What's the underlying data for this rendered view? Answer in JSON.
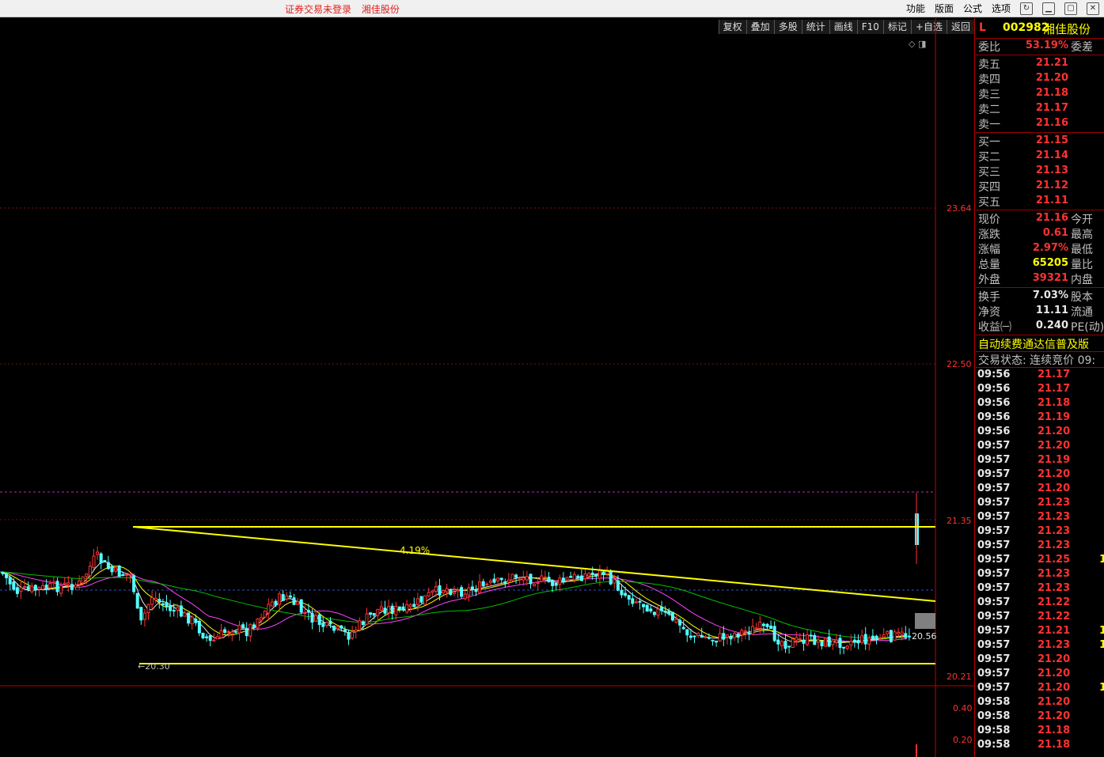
{
  "window": {
    "status_text": "证券交易未登录",
    "stock_name": "湘佳股份",
    "menu": [
      "功能",
      "版面",
      "公式",
      "选项"
    ]
  },
  "toolbar": [
    "复权",
    "叠加",
    "多股",
    "统计",
    "画线",
    "F10",
    "标记",
    "+自选",
    "返回"
  ],
  "chart_labels": {
    "pct_label": "4.19%",
    "low_label": "20.30",
    "ma_label": "20.56",
    "corner_icons": "◇ ◨"
  },
  "chart_data": {
    "type": "candlestick",
    "y_ticks": [
      "23.64",
      "22.50",
      "21.35",
      "20.21"
    ],
    "volume_ticks": [
      "0.40",
      "0.20"
    ],
    "ylim": [
      20.21,
      24.8
    ],
    "annotations": [
      {
        "text": "4.19%",
        "type": "trend-line"
      },
      {
        "text": "20.30",
        "type": "low-marker"
      },
      {
        "text": "20.56",
        "type": "ma-value"
      }
    ]
  },
  "quote": {
    "code": "002982",
    "name": "湘佳股份",
    "flag": "L",
    "weibi_label": "委比",
    "weibi": "53.19%",
    "weicha_label": "委差",
    "sell": [
      {
        "label": "卖五",
        "price": "21.21"
      },
      {
        "label": "卖四",
        "price": "21.20"
      },
      {
        "label": "卖三",
        "price": "21.18"
      },
      {
        "label": "卖二",
        "price": "21.17"
      },
      {
        "label": "卖一",
        "price": "21.16"
      }
    ],
    "buy": [
      {
        "label": "买一",
        "price": "21.15"
      },
      {
        "label": "买二",
        "price": "21.14"
      },
      {
        "label": "买三",
        "price": "21.13"
      },
      {
        "label": "买四",
        "price": "21.12"
      },
      {
        "label": "买五",
        "price": "21.11"
      }
    ],
    "stats1": [
      {
        "label": "现价",
        "value": "21.16",
        "color": "red",
        "label2": "今开"
      },
      {
        "label": "涨跌",
        "value": "0.61",
        "color": "red",
        "label2": "最高"
      },
      {
        "label": "涨幅",
        "value": "2.97%",
        "color": "red",
        "label2": "最低"
      },
      {
        "label": "总量",
        "value": "65205",
        "color": "yel",
        "label2": "量比"
      },
      {
        "label": "外盘",
        "value": "39321",
        "color": "red",
        "label2": "内盘"
      }
    ],
    "stats2": [
      {
        "label": "换手",
        "value": "7.03%",
        "color": "wht",
        "label2": "股本"
      },
      {
        "label": "净资",
        "value": "11.11",
        "color": "wht",
        "label2": "流通"
      },
      {
        "label": "收益㈠",
        "value": "0.240",
        "color": "wht",
        "label2": "PE(动)"
      }
    ],
    "notice": "自动续费通达信普及版",
    "trade_status": "交易状态: 连续竞价 09:",
    "ticks": [
      {
        "t": "09:56",
        "p": "21.17",
        "v": ""
      },
      {
        "t": "09:56",
        "p": "21.17",
        "v": ""
      },
      {
        "t": "09:56",
        "p": "21.18",
        "v": ""
      },
      {
        "t": "09:56",
        "p": "21.19",
        "v": ""
      },
      {
        "t": "09:56",
        "p": "21.20",
        "v": ""
      },
      {
        "t": "09:57",
        "p": "21.20",
        "v": ""
      },
      {
        "t": "09:57",
        "p": "21.19",
        "v": ""
      },
      {
        "t": "09:57",
        "p": "21.20",
        "v": ""
      },
      {
        "t": "09:57",
        "p": "21.20",
        "v": ""
      },
      {
        "t": "09:57",
        "p": "21.23",
        "v": ""
      },
      {
        "t": "09:57",
        "p": "21.23",
        "v": ""
      },
      {
        "t": "09:57",
        "p": "21.23",
        "v": ""
      },
      {
        "t": "09:57",
        "p": "21.23",
        "v": ""
      },
      {
        "t": "09:57",
        "p": "21.25",
        "v": "1"
      },
      {
        "t": "09:57",
        "p": "21.23",
        "v": ""
      },
      {
        "t": "09:57",
        "p": "21.23",
        "v": ""
      },
      {
        "t": "09:57",
        "p": "21.22",
        "v": ""
      },
      {
        "t": "09:57",
        "p": "21.22",
        "v": ""
      },
      {
        "t": "09:57",
        "p": "21.21",
        "v": "1"
      },
      {
        "t": "09:57",
        "p": "21.23",
        "v": "1"
      },
      {
        "t": "09:57",
        "p": "21.20",
        "v": ""
      },
      {
        "t": "09:57",
        "p": "21.20",
        "v": ""
      },
      {
        "t": "09:57",
        "p": "21.20",
        "v": "1"
      },
      {
        "t": "09:58",
        "p": "21.20",
        "v": ""
      },
      {
        "t": "09:58",
        "p": "21.20",
        "v": ""
      },
      {
        "t": "09:58",
        "p": "21.18",
        "v": ""
      },
      {
        "t": "09:58",
        "p": "21.18",
        "v": ""
      }
    ]
  }
}
